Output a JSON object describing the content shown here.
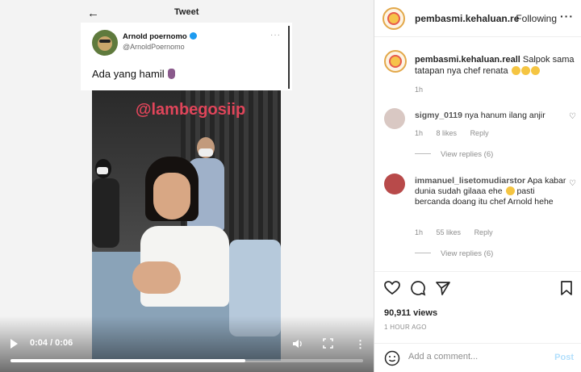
{
  "video": {
    "tweet": {
      "header_title": "Tweet",
      "author_name": "Arnold poernomo",
      "author_handle": "@ArnoldPoernomo",
      "text": "Ada yang hamil"
    },
    "watermark": "@lambegosiip",
    "time_display": "0:04 / 0:06",
    "progress": 0.667
  },
  "post": {
    "header": {
      "username": "pembasmi.kehaluan.re",
      "follow_label": "Following"
    },
    "caption": {
      "username": "pembasmi.kehaluan.reall",
      "text": "Salpok sama tatapan nya chef renata",
      "time": "1h"
    },
    "comments": [
      {
        "username": "sigmy_0119",
        "text": "nya hanum ilang anjir",
        "time": "1h",
        "likes": "8 likes",
        "reply_label": "Reply",
        "view_replies": "View replies (6)"
      },
      {
        "username": "immanuel_lisetomudiarstor",
        "text": "Apa kabar dunia sudah gilaaa ehe",
        "text2": "pasti bercanda doang itu chef Arnold hehe",
        "time": "1h",
        "likes": "55 likes",
        "reply_label": "Reply",
        "view_replies": "View replies (6)"
      }
    ],
    "views": "90,911 views",
    "posted_ago": "1 HOUR AGO",
    "add_comment_placeholder": "Add a comment...",
    "post_label": "Post"
  },
  "icons": {
    "back": "arrow-left-icon",
    "play": "play-icon",
    "volume": "volume-icon",
    "fullscreen": "fullscreen-icon",
    "like": "heart-icon",
    "comment": "comment-icon",
    "share": "share-icon",
    "save": "bookmark-icon",
    "emoji": "smile-icon"
  }
}
